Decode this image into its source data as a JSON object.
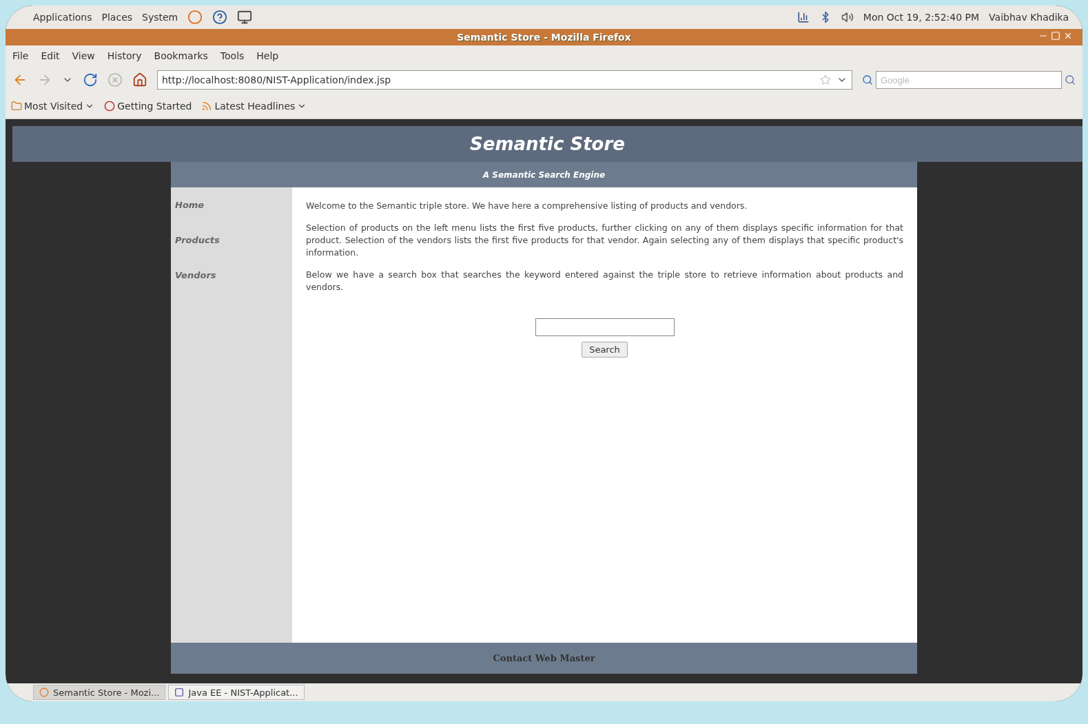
{
  "top_panel": {
    "menus": [
      "Applications",
      "Places",
      "System"
    ],
    "clock": "Mon Oct 19,  2:52:40 PM",
    "user": "Vaibhav Khadika"
  },
  "window": {
    "title": "Semantic Store - Mozilla Firefox"
  },
  "menu_bar": [
    "File",
    "Edit",
    "View",
    "History",
    "Bookmarks",
    "Tools",
    "Help"
  ],
  "nav": {
    "url": "http://localhost:8080/NIST-Application/index.jsp",
    "search_placeholder": "Google"
  },
  "bookmarks": [
    {
      "label": "Most Visited",
      "dropdown": true
    },
    {
      "label": "Getting Started",
      "dropdown": false
    },
    {
      "label": "Latest Headlines",
      "dropdown": true
    }
  ],
  "page": {
    "title": "Semantic Store",
    "subtitle": "A Semantic Search Engine",
    "sidebar": [
      "Home",
      "Products",
      "Vendors"
    ],
    "paragraphs": [
      "Welcome to the Semantic triple store. We have here a comprehensive listing of products and vendors.",
      "Selection of products on the left menu lists the first five products, further clicking on any of them displays specific information for that product. Selection of the vendors lists the first five products for that vendor. Again selecting any of them displays that specific product's information.",
      "Below we have a search box that searches the keyword entered against the triple store to retrieve information about products and vendors."
    ],
    "search_button": "Search",
    "footer": "Contact Web Master"
  },
  "taskbar": [
    {
      "label": "Semantic Store - Mozi...",
      "selected": true
    },
    {
      "label": "Java EE - NIST-Applicat...",
      "selected": false
    }
  ]
}
